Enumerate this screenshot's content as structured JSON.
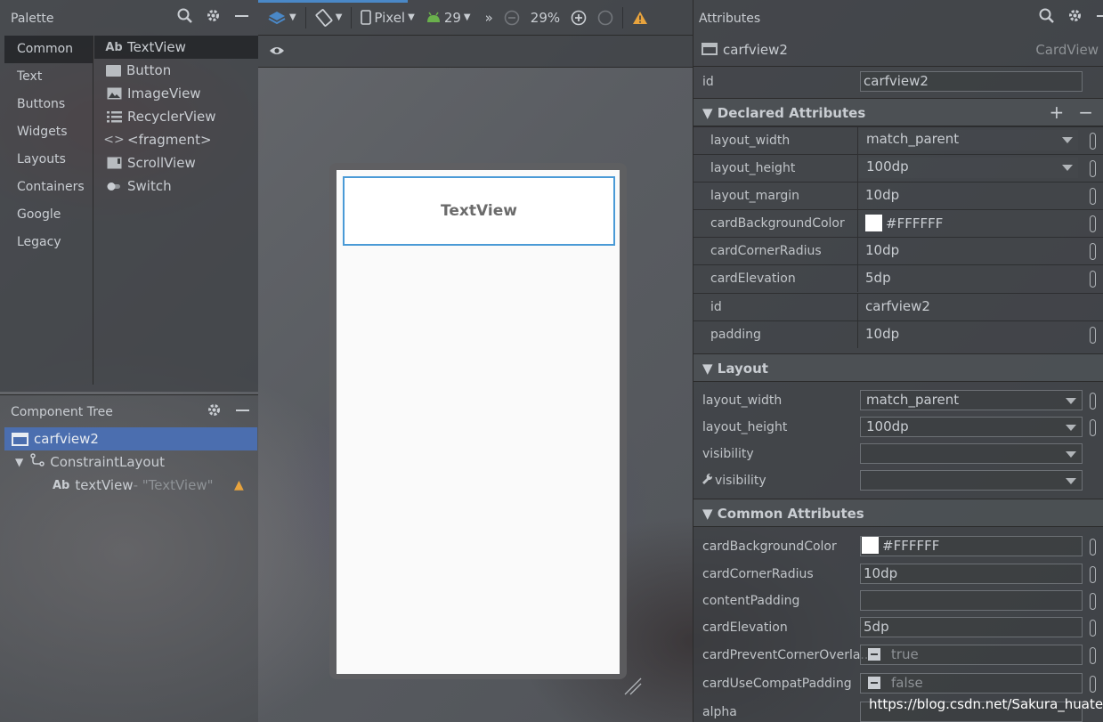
{
  "palette": {
    "title": "Palette",
    "categories": [
      "Common",
      "Text",
      "Buttons",
      "Widgets",
      "Layouts",
      "Containers",
      "Google",
      "Legacy"
    ],
    "items": [
      {
        "label": "TextView",
        "icon": "ab-text-icon"
      },
      {
        "label": "Button",
        "icon": "button-icon"
      },
      {
        "label": "ImageView",
        "icon": "image-icon"
      },
      {
        "label": "RecyclerView",
        "icon": "list-icon"
      },
      {
        "label": "<fragment>",
        "icon": "code-brackets-icon"
      },
      {
        "label": "ScrollView",
        "icon": "scroll-icon"
      },
      {
        "label": "Switch",
        "icon": "switch-icon"
      }
    ]
  },
  "tree": {
    "title": "Component Tree",
    "nodes": [
      {
        "label": "carfview2"
      },
      {
        "label": "ConstraintLayout"
      },
      {
        "label": "textView",
        "suffix": "- \"TextView\""
      }
    ]
  },
  "toolbar": {
    "device": "Pixel",
    "api": "29",
    "zoom": "29%",
    "more": "»"
  },
  "preview": {
    "card_text": "TextView"
  },
  "attributes": {
    "title": "Attributes",
    "component_name": "carfview2",
    "component_type": "CardView",
    "id_label": "id",
    "id_value": "carfview2",
    "declared_title": "Declared Attributes",
    "declared": [
      {
        "label": "layout_width",
        "value": "match_parent"
      },
      {
        "label": "layout_height",
        "value": "100dp"
      },
      {
        "label": "layout_margin",
        "value": "10dp"
      },
      {
        "label": "cardBackgroundColor",
        "value": "#FFFFFF"
      },
      {
        "label": "cardCornerRadius",
        "value": "10dp"
      },
      {
        "label": "cardElevation",
        "value": "5dp"
      },
      {
        "label": "id",
        "value": "carfview2"
      },
      {
        "label": "padding",
        "value": "10dp"
      }
    ],
    "layout_title": "Layout",
    "layout": [
      {
        "label": "layout_width",
        "value": "match_parent"
      },
      {
        "label": "layout_height",
        "value": "100dp"
      },
      {
        "label": "visibility",
        "value": ""
      },
      {
        "label": "visibility",
        "value": ""
      }
    ],
    "common_title": "Common Attributes",
    "common": [
      {
        "label": "cardBackgroundColor",
        "value": "#FFFFFF"
      },
      {
        "label": "cardCornerRadius",
        "value": "10dp"
      },
      {
        "label": "contentPadding",
        "value": ""
      },
      {
        "label": "cardElevation",
        "value": "5dp"
      },
      {
        "label": "cardPreventCornerOverla..",
        "value": "true"
      },
      {
        "label": "cardUseCompatPadding",
        "value": "false"
      },
      {
        "label": "alpha",
        "value": ""
      }
    ]
  },
  "watermark": "https://blog.csdn.net/Sakura_huatex",
  "colors": {
    "selection": "#4b6eaf",
    "accent": "#4a88c7",
    "warning": "#e8a33d",
    "card_border": "#4a9ad6"
  }
}
